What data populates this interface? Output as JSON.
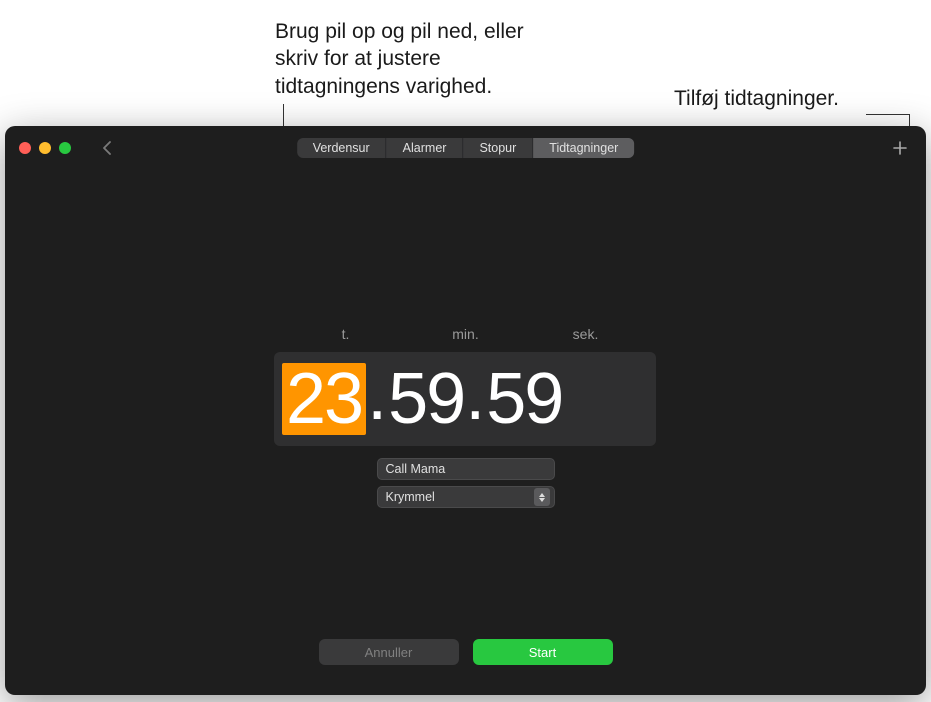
{
  "callouts": {
    "duration": "Brug pil op og pil ned, eller skriv for at justere tidtagningens varighed.",
    "add": "Tilføj tidtagninger."
  },
  "tabs": [
    "Verdensur",
    "Alarmer",
    "Stopur",
    "Tidtagninger"
  ],
  "active_tab_index": 3,
  "time_labels": {
    "hours": "t.",
    "minutes": "min.",
    "seconds": "sek."
  },
  "timer": {
    "hours": "23",
    "minutes": "59",
    "seconds": "59"
  },
  "name_value": "Call Mama",
  "sound_value": "Krymmel",
  "buttons": {
    "cancel": "Annuller",
    "start": "Start"
  },
  "colors": {
    "accent_orange": "#ff9500",
    "start_green": "#28c840"
  }
}
